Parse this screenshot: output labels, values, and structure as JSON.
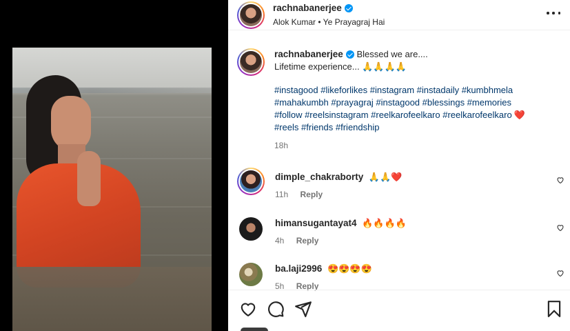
{
  "post": {
    "username": "rachnabanerjee",
    "subtitle": "Alok Kumar • Ye Prayagraj Hai"
  },
  "caption": {
    "username": "rachnabanerjee",
    "line1": "Blessed we are....",
    "line2": "Lifetime experience... 🙏🙏🙏🙏",
    "hashtags_line1": "#instagood #likeforlikes #instagram #instadaily #kumbhmela",
    "hashtags_line2": "#mahakumbh #prayagraj #instagood #blessings #memories",
    "hashtags_line3": "#follow #reelsinstagram #reelkarofeelkaro #reelkarofeelkaro",
    "hashtags_line3_emoji": "❤️",
    "hashtags_line4": "#reels #friends #friendship",
    "time": "18h"
  },
  "comments": [
    {
      "username": "dimple_chakraborty",
      "text": "🙏🙏❤️",
      "time": "11h",
      "reply": "Reply"
    },
    {
      "username": "himansugantayat4",
      "text": "🔥🔥🔥🔥",
      "time": "4h",
      "reply": "Reply"
    },
    {
      "username": "ba.laji2996",
      "text": "😍😍😍😍",
      "time": "5h",
      "reply": "Reply"
    }
  ],
  "icons": {
    "like": "heart-icon",
    "comment": "comment-icon",
    "share": "share-icon",
    "save": "bookmark-icon",
    "more": "more-options-icon",
    "verified": "verified-icon"
  },
  "colors": {
    "verified": "#0095f6",
    "hashtag": "#00376b",
    "muted": "#737373"
  }
}
